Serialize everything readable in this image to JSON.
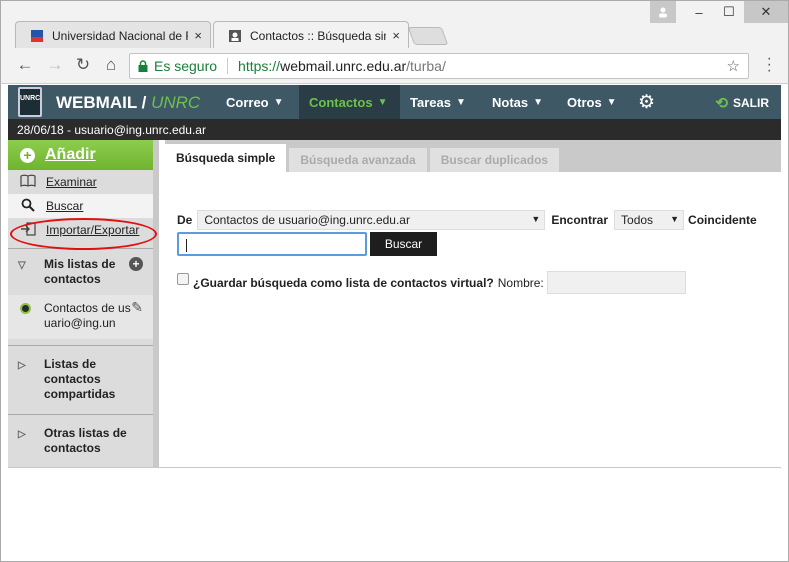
{
  "browser": {
    "tabs": [
      {
        "title": "Universidad Nacional de Río Cuarto",
        "close": "×"
      },
      {
        "title": "Contactos :: Búsqueda simple",
        "close": "×"
      }
    ],
    "window_controls": {
      "minimize": "–",
      "maximize": "☐",
      "close": "✕"
    },
    "nav": {
      "back": "←",
      "forward": "→",
      "reload": "↻",
      "home": "⌂"
    },
    "address": {
      "secure_label": "Es seguro",
      "scheme": "https://",
      "host": "webmail.unrc.edu.ar",
      "path": "/turba/",
      "star": "☆"
    }
  },
  "app": {
    "logo_text": "UNRC",
    "brand_main": "WEBMAIL /",
    "brand_accent": "UNRC",
    "menu": [
      {
        "label": "Correo",
        "caret": "▼"
      },
      {
        "label": "Contactos",
        "caret": "▼"
      },
      {
        "label": "Tareas",
        "caret": "▼"
      },
      {
        "label": "Notas",
        "caret": "▼"
      },
      {
        "label": "Otros",
        "caret": "▼"
      }
    ],
    "gear": "⚙",
    "logout_icon": "⟲",
    "logout": "SALIR",
    "info": "28/06/18 - usuario@ing.unrc.edu.ar"
  },
  "sidebar": {
    "add_label": "Añadir",
    "add_icon": "+",
    "items": [
      {
        "label": "Examinar",
        "icon": "📖"
      },
      {
        "label": "Buscar",
        "icon": "⚲"
      },
      {
        "label": "Importar/Exportar",
        "icon": "⇥"
      }
    ],
    "sections": {
      "mis_listas": "Mis listas de contactos",
      "contact_name": "Contactos de usuario@ing.un",
      "compartidas": "Listas de contactos compartidas",
      "otras": "Otras listas de contactos"
    },
    "tri_open": "▽",
    "tri_closed": "▷",
    "add_list_icon": "+",
    "pencil": "✎"
  },
  "main": {
    "tabs": [
      "Búsqueda simple",
      "Búsqueda avanzada",
      "Buscar duplicados"
    ],
    "de_label": "De",
    "source_value": "Contactos de usuario@ing.unrc.edu.ar",
    "encontrar_label": "Encontrar",
    "find_value": "Todos",
    "coincidente_label": "Coincidente",
    "dd_caret": "▼",
    "query_value": "",
    "search_button": "Buscar",
    "save_question": "¿Guardar búsqueda como lista de contactos virtual?",
    "nombre_label": "Nombre:",
    "nombre_value": ""
  },
  "colors": {
    "header": "#3f5866",
    "accent": "#6cc24a",
    "annotation_ring": "#e01010"
  }
}
